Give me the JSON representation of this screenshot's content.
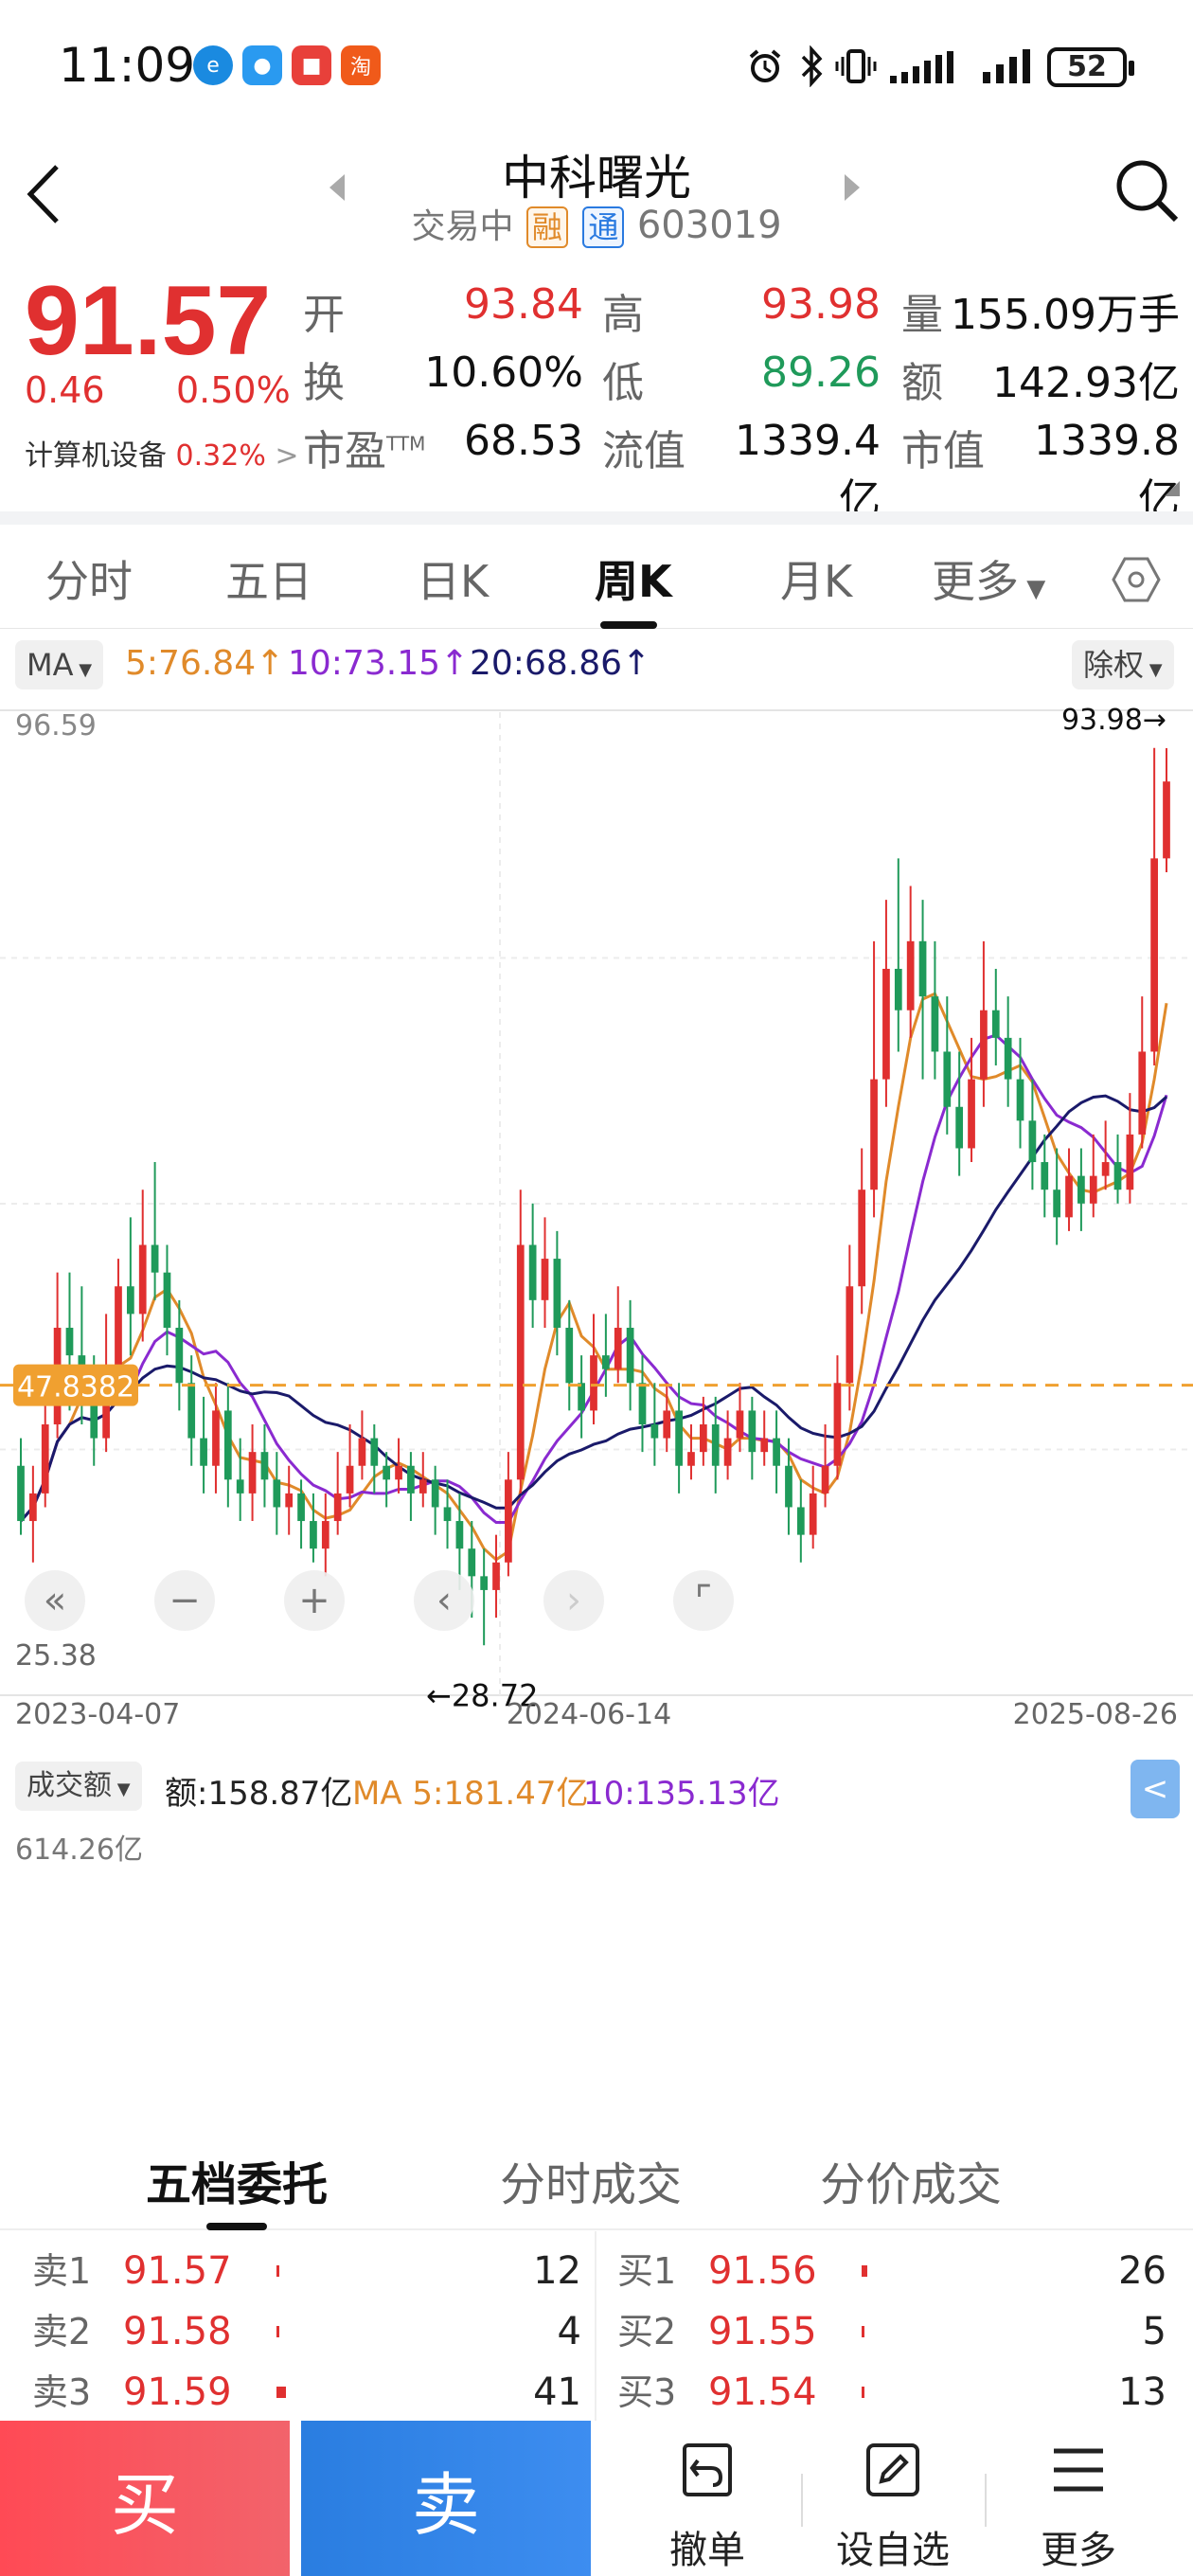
{
  "status": {
    "time": "11:09",
    "battery": "52"
  },
  "header": {
    "name": "中科曙光",
    "status": "交易中",
    "tag_rong": "融",
    "tag_tong": "通",
    "code": "603019"
  },
  "quote": {
    "price": "91.57",
    "change": "0.46",
    "change_pct": "0.50%",
    "sector": "计算机设备",
    "sector_pct": "0.32%",
    "open_label": "开",
    "open": "93.84",
    "high_label": "高",
    "high": "93.98",
    "volume_label": "量",
    "volume": "155.09万手",
    "turnover_label": "换",
    "turnover": "10.60%",
    "low_label": "低",
    "low": "89.26",
    "amount_label": "额",
    "amount": "142.93亿",
    "pe_label": "市盈",
    "pe_sup": "TTM",
    "pe": "68.53",
    "float_cap_label": "流值",
    "float_cap": "1339.4亿",
    "mkt_cap_label": "市值",
    "mkt_cap": "1339.8亿"
  },
  "tabs": [
    "分时",
    "五日",
    "日K",
    "周K",
    "月K",
    "更多"
  ],
  "ma_bar": {
    "ma_button": "MA",
    "ma5": "5:76.84↑",
    "ma10": "10:73.15↑",
    "ma20": "20:68.86↑",
    "adjust_button": "除权"
  },
  "colors": {
    "up": "#e03030",
    "down": "#1f9a5a",
    "ma5": "#e08a2a",
    "ma10": "#8a2ad0",
    "ma20": "#1a1a6a",
    "ref_line": "#f0a030"
  },
  "chart_data": {
    "type": "candlestick",
    "y_max_label": "96.59",
    "y_min_label": "25.38",
    "ylim": [
      25.38,
      96.59
    ],
    "ref_price": "47.8382",
    "high_marker": "93.98→",
    "low_marker": "←28.72",
    "x_labels": [
      "2023-04-07",
      "2024-06-14",
      "2025-08-26"
    ],
    "candles": [
      [
        42,
        38,
        44,
        37
      ],
      [
        38,
        40,
        42,
        35
      ],
      [
        40,
        45,
        47,
        39
      ],
      [
        45,
        52,
        56,
        44
      ],
      [
        52,
        50,
        56,
        46
      ],
      [
        50,
        48,
        55,
        45
      ],
      [
        48,
        44,
        50,
        42
      ],
      [
        44,
        49,
        53,
        43
      ],
      [
        49,
        55,
        57,
        47
      ],
      [
        55,
        53,
        60,
        50
      ],
      [
        53,
        58,
        62,
        51
      ],
      [
        58,
        56,
        64,
        54
      ],
      [
        56,
        52,
        58,
        50
      ],
      [
        52,
        48,
        54,
        46
      ],
      [
        48,
        44,
        50,
        42
      ],
      [
        44,
        42,
        47,
        40
      ],
      [
        42,
        46,
        48,
        40
      ],
      [
        46,
        41,
        48,
        39
      ],
      [
        41,
        40,
        44,
        38
      ],
      [
        40,
        43,
        45,
        38
      ],
      [
        43,
        41,
        45,
        39
      ],
      [
        41,
        39,
        43,
        37
      ],
      [
        39,
        40,
        42,
        37
      ],
      [
        40,
        38,
        41,
        36
      ],
      [
        38,
        36,
        40,
        35
      ],
      [
        36,
        38,
        40,
        34
      ],
      [
        38,
        40,
        43,
        37
      ],
      [
        40,
        42,
        45,
        39
      ],
      [
        42,
        44,
        46,
        41
      ],
      [
        44,
        42,
        45,
        40
      ],
      [
        42,
        41,
        43,
        39
      ],
      [
        41,
        42,
        44,
        40
      ],
      [
        42,
        40,
        43,
        38
      ],
      [
        40,
        41,
        43,
        39
      ],
      [
        41,
        39,
        42,
        37
      ],
      [
        39,
        38,
        41,
        36
      ],
      [
        38,
        36,
        40,
        33
      ],
      [
        36,
        34,
        38,
        31
      ],
      [
        34,
        33,
        36,
        29
      ],
      [
        33,
        35,
        37,
        31
      ],
      [
        35,
        41,
        43,
        34
      ],
      [
        41,
        58,
        62,
        40
      ],
      [
        58,
        54,
        61,
        52
      ],
      [
        54,
        57,
        60,
        52
      ],
      [
        57,
        52,
        59,
        50
      ],
      [
        52,
        48,
        54,
        46
      ],
      [
        48,
        46,
        50,
        44
      ],
      [
        46,
        50,
        53,
        45
      ],
      [
        50,
        49,
        53,
        47
      ],
      [
        49,
        52,
        55,
        48
      ],
      [
        52,
        48,
        54,
        46
      ],
      [
        48,
        45,
        50,
        43
      ],
      [
        45,
        44,
        48,
        42
      ],
      [
        44,
        46,
        48,
        43
      ],
      [
        46,
        42,
        48,
        40
      ],
      [
        42,
        43,
        45,
        41
      ],
      [
        43,
        45,
        47,
        42
      ],
      [
        45,
        42,
        47,
        40
      ],
      [
        42,
        44,
        46,
        41
      ],
      [
        44,
        46,
        48,
        43
      ],
      [
        46,
        43,
        47,
        41
      ],
      [
        43,
        44,
        46,
        42
      ],
      [
        44,
        42,
        46,
        40
      ],
      [
        42,
        39,
        44,
        37
      ],
      [
        39,
        37,
        41,
        35
      ],
      [
        37,
        40,
        42,
        36
      ],
      [
        40,
        42,
        45,
        39
      ],
      [
        42,
        48,
        50,
        41
      ],
      [
        48,
        55,
        58,
        46
      ],
      [
        55,
        62,
        65,
        53
      ],
      [
        62,
        70,
        80,
        60
      ],
      [
        70,
        78,
        83,
        68
      ],
      [
        78,
        75,
        86,
        72
      ],
      [
        75,
        80,
        84,
        73
      ],
      [
        80,
        76,
        83,
        70
      ],
      [
        76,
        72,
        80,
        70
      ],
      [
        72,
        68,
        76,
        66
      ],
      [
        68,
        65,
        72,
        63
      ],
      [
        65,
        70,
        73,
        64
      ],
      [
        70,
        75,
        80,
        68
      ],
      [
        75,
        73,
        78,
        71
      ],
      [
        73,
        70,
        76,
        68
      ],
      [
        70,
        67,
        73,
        65
      ],
      [
        67,
        64,
        70,
        62
      ],
      [
        64,
        62,
        66,
        60
      ],
      [
        62,
        60,
        65,
        58
      ],
      [
        60,
        63,
        65,
        59
      ],
      [
        63,
        61,
        65,
        59
      ],
      [
        61,
        63,
        66,
        60
      ],
      [
        63,
        64,
        67,
        62
      ],
      [
        64,
        62,
        66,
        61
      ],
      [
        62,
        66,
        69,
        61
      ],
      [
        66,
        72,
        76,
        65
      ],
      [
        72,
        86,
        94,
        71
      ],
      [
        86,
        91.57,
        93.98,
        85
      ]
    ]
  },
  "volume": {
    "button": "成交额",
    "amount": "额:158.87亿",
    "ma5": "MA 5:181.47亿",
    "ma10": "10:135.13亿",
    "max_label": "614.26亿"
  },
  "orderbook": {
    "tabs": [
      "五档委托",
      "分时成交",
      "分价成交"
    ],
    "asks": [
      {
        "label": "卖1",
        "price": "91.57",
        "vol": "12",
        "frac": 0.3
      },
      {
        "label": "卖2",
        "price": "91.58",
        "vol": "4",
        "frac": 0.1
      },
      {
        "label": "卖3",
        "price": "91.59",
        "vol": "41",
        "frac": 1.0
      }
    ],
    "bids": [
      {
        "label": "买1",
        "price": "91.56",
        "vol": "26",
        "frac": 0.63
      },
      {
        "label": "买2",
        "price": "91.55",
        "vol": "5",
        "frac": 0.12
      },
      {
        "label": "买3",
        "price": "91.54",
        "vol": "13",
        "frac": 0.32
      }
    ]
  },
  "bottom": {
    "buy": "买",
    "sell": "卖",
    "cancel": "撤单",
    "watchlist": "设自选",
    "more": "更多"
  }
}
